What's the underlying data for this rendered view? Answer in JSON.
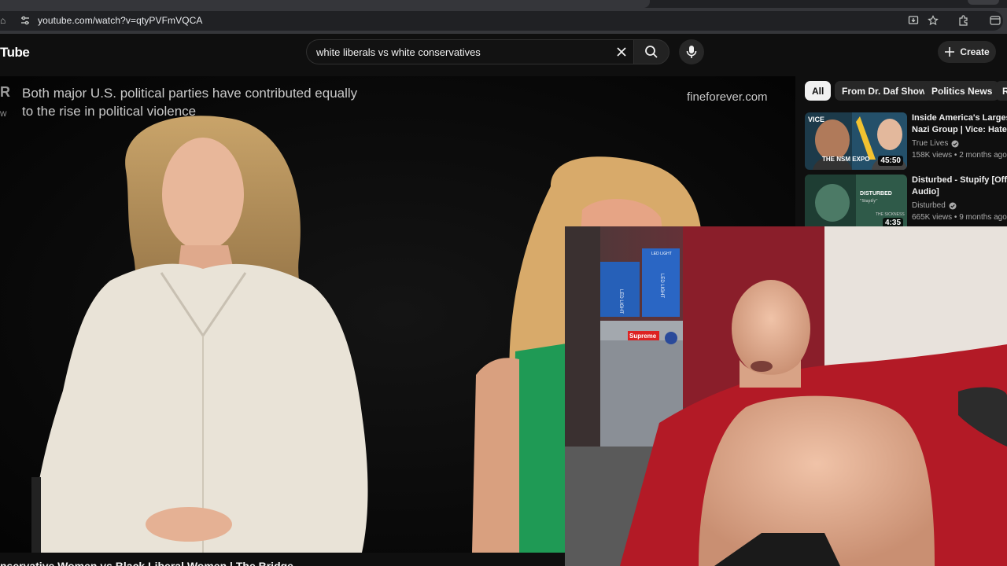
{
  "browser": {
    "url": "youtube.com/watch?v=qtyPVFmVQCA",
    "icons": [
      "home-icon",
      "site-info-icon",
      "install-icon",
      "bookmark-star-icon",
      "extensions-icon",
      "profile-icon"
    ]
  },
  "masthead": {
    "logo": "Tube",
    "search_value": "white liberals vs white conservatives",
    "create_label": "Create"
  },
  "video": {
    "overlay_text": "Both major U.S. political parties have contributed equally to the rise in political violence",
    "watermark": "fineforever.com",
    "channel_mark": "R",
    "channel_mark_sub": "W",
    "title_partial": "nservative Women vs Black Liberal Women | The Bridge"
  },
  "chips": [
    {
      "label": "All",
      "active": true
    },
    {
      "label": "From Dr. Daf Show",
      "active": false
    },
    {
      "label": "Politics News",
      "active": false
    },
    {
      "label": "R",
      "active": false
    }
  ],
  "recommendations": [
    {
      "title_line1": "Inside America's Largest",
      "title_line2": "Nazi Group | Vice: Hate T",
      "channel": "True Lives",
      "meta": "158K views • 2 months ago",
      "duration": "45:50",
      "thumb_text_top": "VICE",
      "thumb_text_bottom": "THE NSM EXPO"
    },
    {
      "title_line1": "Disturbed - Stupify [Offici",
      "title_line2": "Audio]",
      "channel": "Disturbed",
      "meta": "665K views • 9 months ago",
      "duration": "4:35",
      "thumb_text_top": "DISTURBED",
      "thumb_text_sub": "\"Stupify\"",
      "thumb_text_bottom": "THE SICKNESS"
    }
  ],
  "webcam": {
    "box_labels": [
      "LED LIGHT",
      "LED LIGHT",
      "LED LIGHT"
    ],
    "sticker": "Supreme"
  }
}
